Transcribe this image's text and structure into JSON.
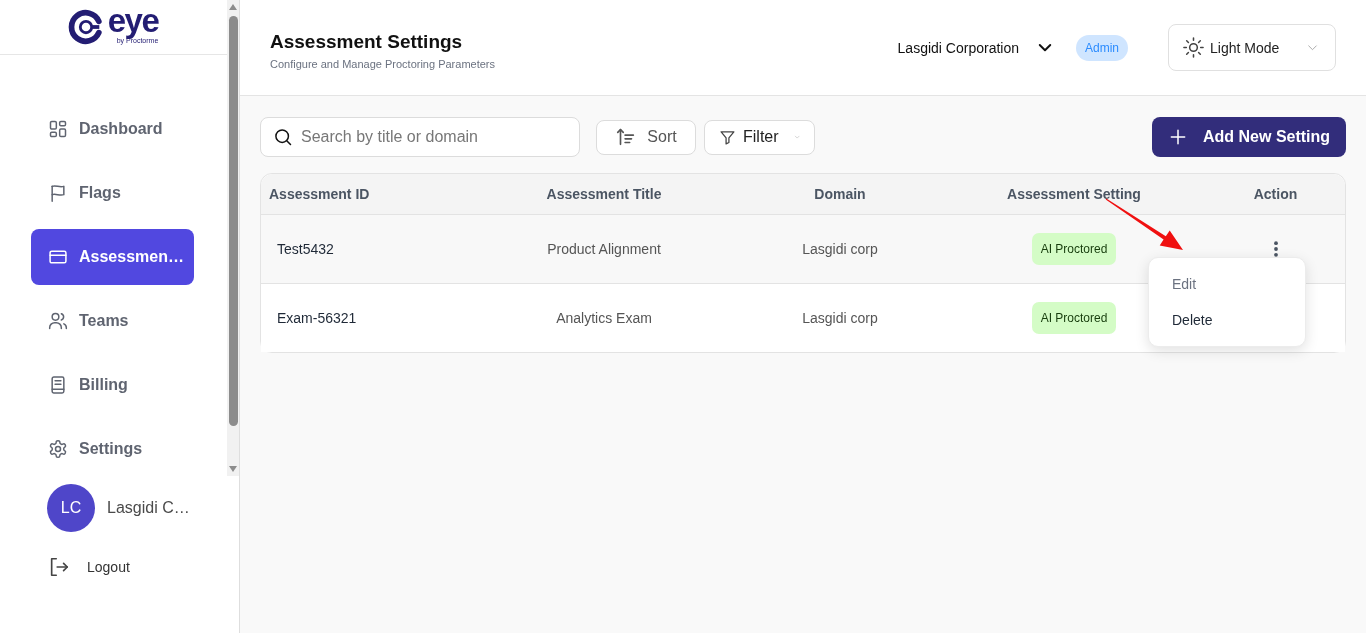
{
  "sidebar": {
    "logo": {
      "text": "eye",
      "tagline": "by Proctorme"
    },
    "nav_items": [
      {
        "label": "Dashboard",
        "selected": false
      },
      {
        "label": "Flags",
        "selected": false
      },
      {
        "label": "Assessmen…",
        "selected": true
      },
      {
        "label": "Teams",
        "selected": false
      },
      {
        "label": "Billing",
        "selected": false
      },
      {
        "label": "Settings",
        "selected": false
      }
    ],
    "profile": {
      "initials": "LC",
      "name": "Lasgidi C…"
    },
    "logout": {
      "label": "Logout"
    }
  },
  "header": {
    "title": "Assessment Settings",
    "subtitle": "Configure and Manage Proctoring Parameters",
    "organization": "Lasgidi Corporation",
    "role_badge": "Admin",
    "theme_select": {
      "value": "Light Mode"
    }
  },
  "toolbar": {
    "search": {
      "placeholder": "Search by title or domain"
    },
    "sort_button": "Sort",
    "filter_button": "Filter",
    "add_button": "Add New Setting"
  },
  "table": {
    "columns": [
      "Assessment ID",
      "Assessment Title",
      "Domain",
      "Assessment Setting",
      "Action"
    ],
    "rows": [
      {
        "id": "Test5432",
        "title": "Product Alignment",
        "domain": "Lasgidi corp",
        "setting": "AI Proctored",
        "menu_open": true
      },
      {
        "id": "Exam-56321",
        "title": "Analytics Exam",
        "domain": "Lasgidi corp",
        "setting": "AI Proctored",
        "menu_open": false
      }
    ],
    "action_menu": {
      "items": [
        {
          "label": "Edit",
          "disabled": true
        },
        {
          "label": "Delete",
          "disabled": false
        }
      ]
    }
  },
  "annotation": {
    "kind": "arrow"
  }
}
